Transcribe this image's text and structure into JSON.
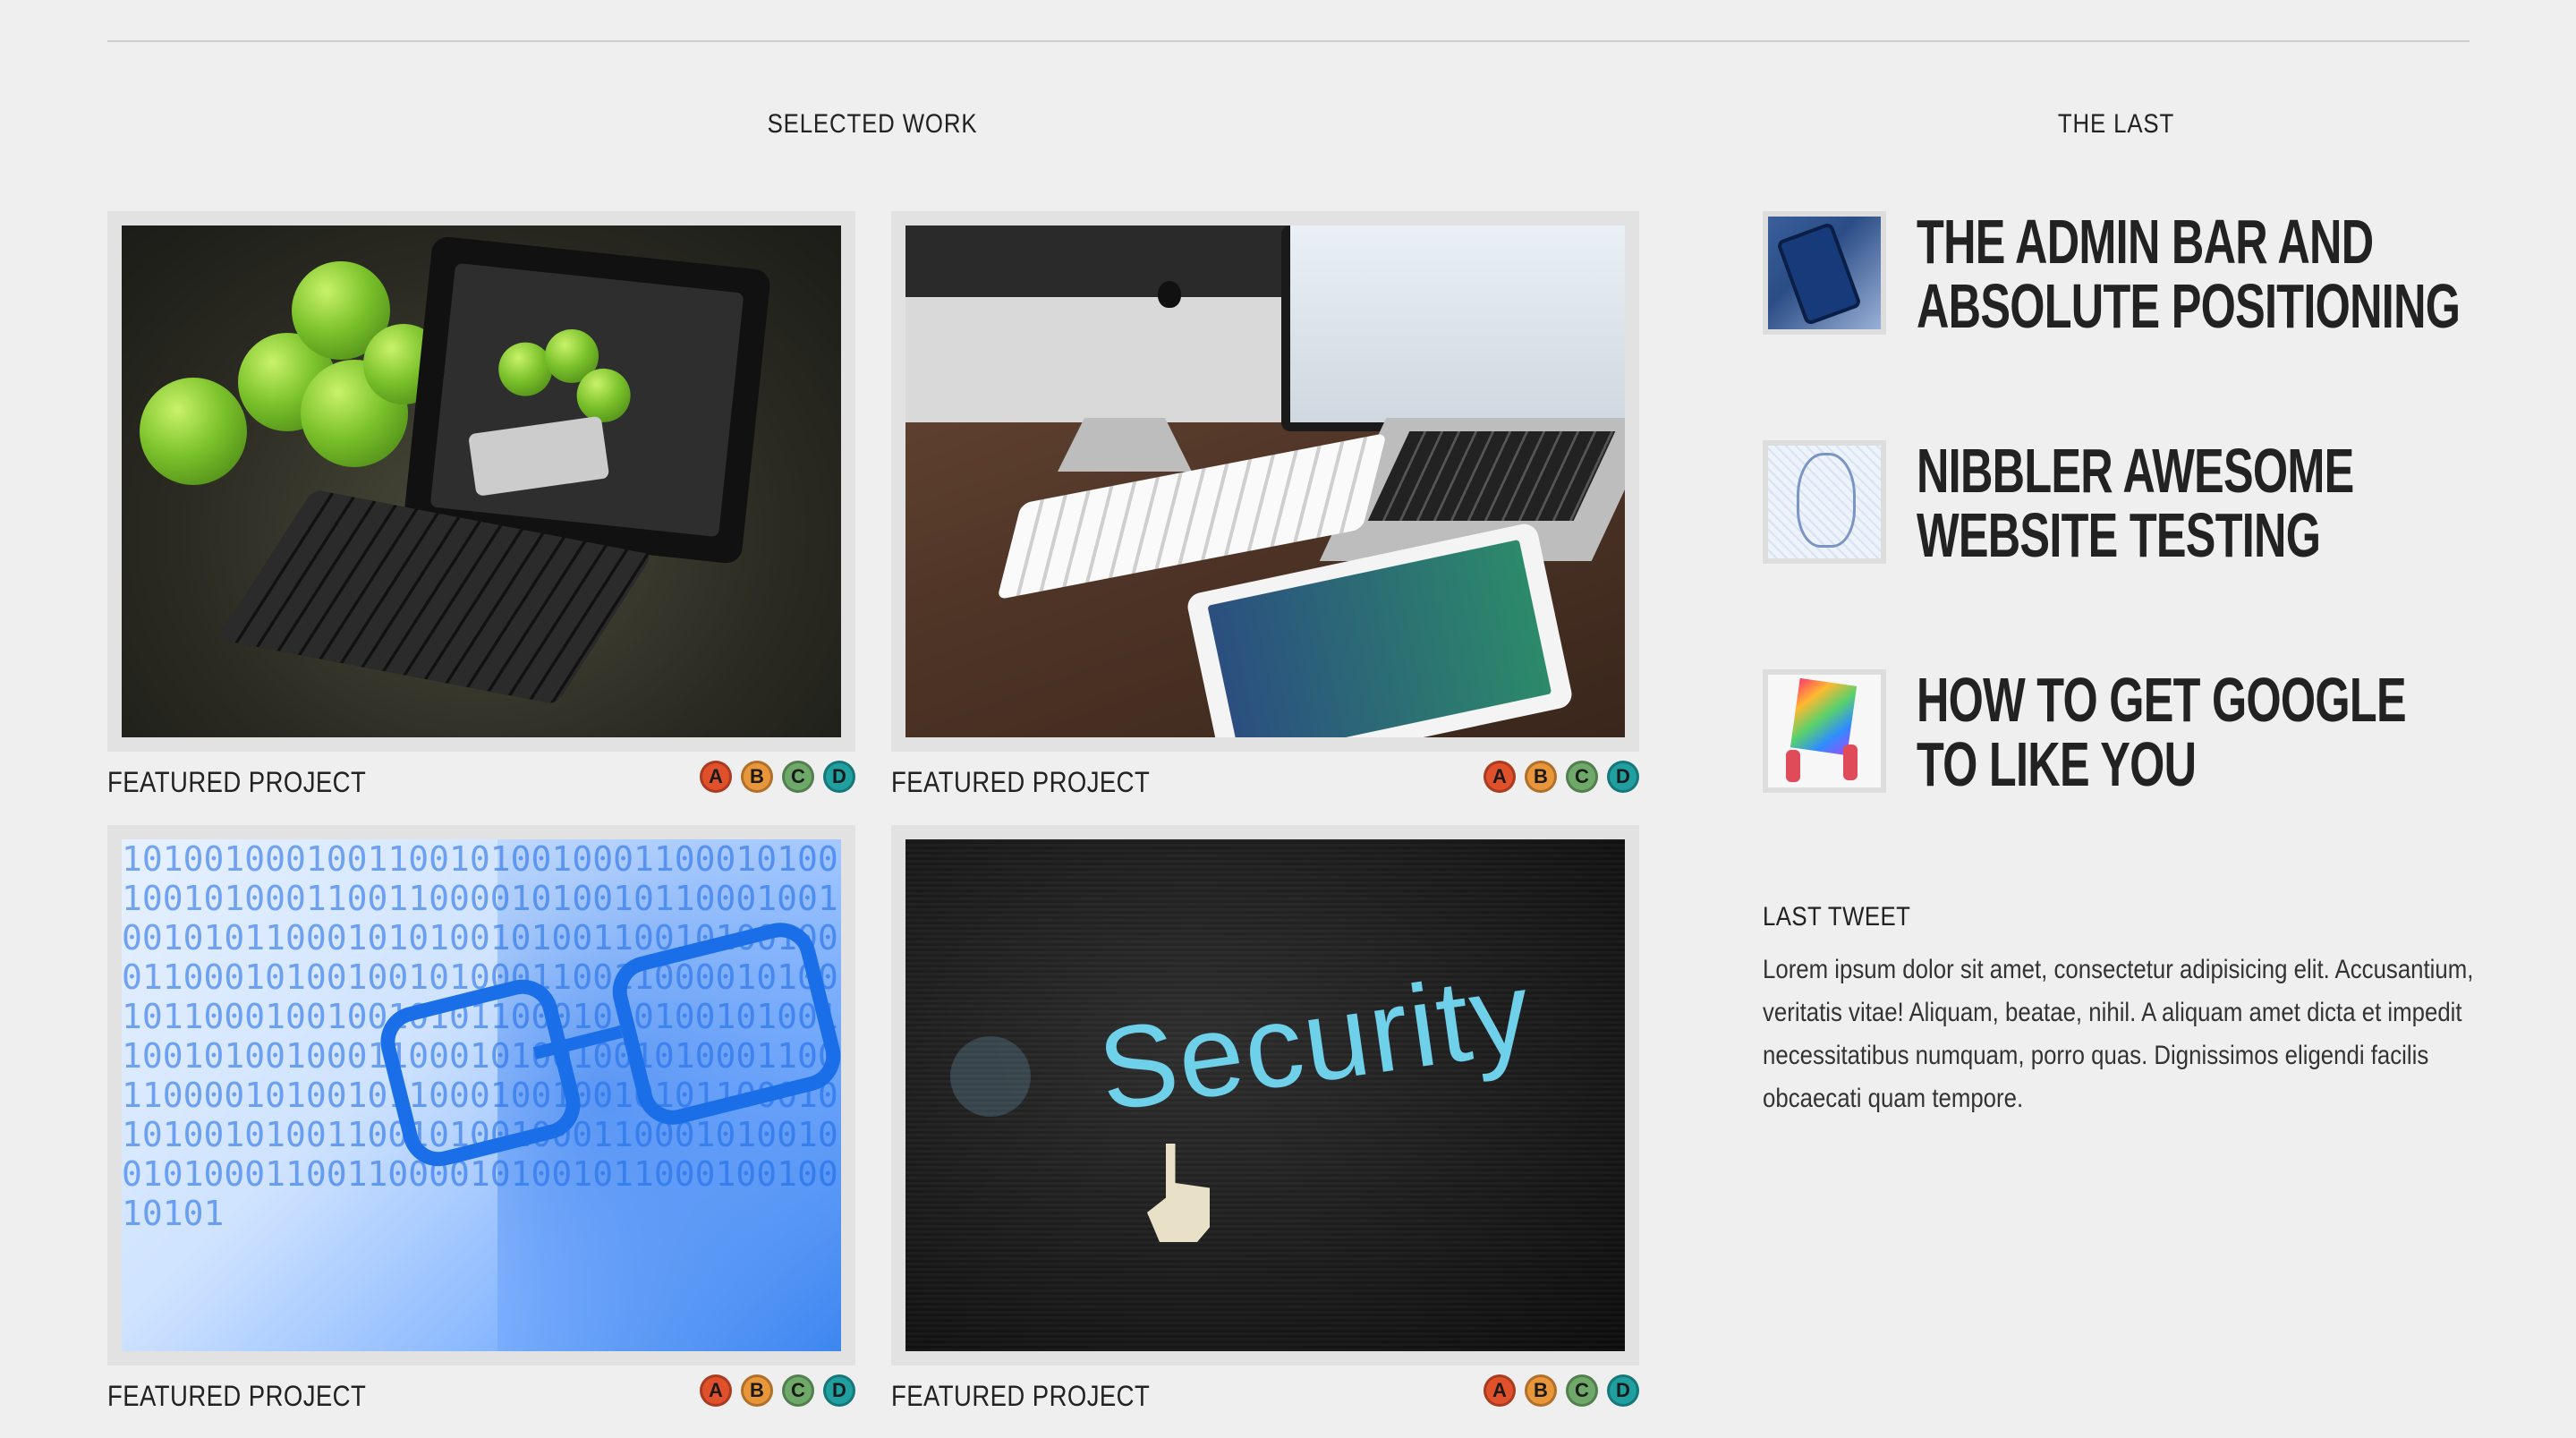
{
  "selected_work": {
    "title": "SELECTED WORK",
    "projects": [
      {
        "label": "FEATURED PROJECT",
        "image": "tablet-with-apples"
      },
      {
        "label": "FEATURED PROJECT",
        "image": "desk-with-imac-laptop-ipad"
      },
      {
        "label": "FEATURED PROJECT",
        "image": "man-with-glasses-binary"
      },
      {
        "label": "FEATURED PROJECT",
        "image": "security-screen"
      }
    ],
    "badges": [
      {
        "letter": "A",
        "color": "#e0502b"
      },
      {
        "letter": "B",
        "color": "#e9963a"
      },
      {
        "letter": "C",
        "color": "#6fa96a"
      },
      {
        "letter": "D",
        "color": "#1f9fa0"
      }
    ]
  },
  "the_last": {
    "title": "THE LAST",
    "posts": [
      {
        "title": "THE ADMIN BAR AND ABSOLUTE POSITIONING",
        "thumb": "phone-keyboard"
      },
      {
        "title": "NIBBLER AWESOME WEBSITE TESTING",
        "thumb": "wireframe-face"
      },
      {
        "title": "HOW TO GET GOOGLE TO LIKE YOU",
        "thumb": "colorful-tablet"
      }
    ]
  },
  "last_tweet": {
    "title": "LAST TWEET",
    "body": "Lorem ipsum dolor sit amet, consectetur adipisicing elit. Accusantium, veritatis vitae! Aliquam, beatae, nihil. A aliquam amet dicta et impedit necessitatibus numquam, porro quas. Dignissimos eligendi facilis obcaecati quam tempore."
  }
}
